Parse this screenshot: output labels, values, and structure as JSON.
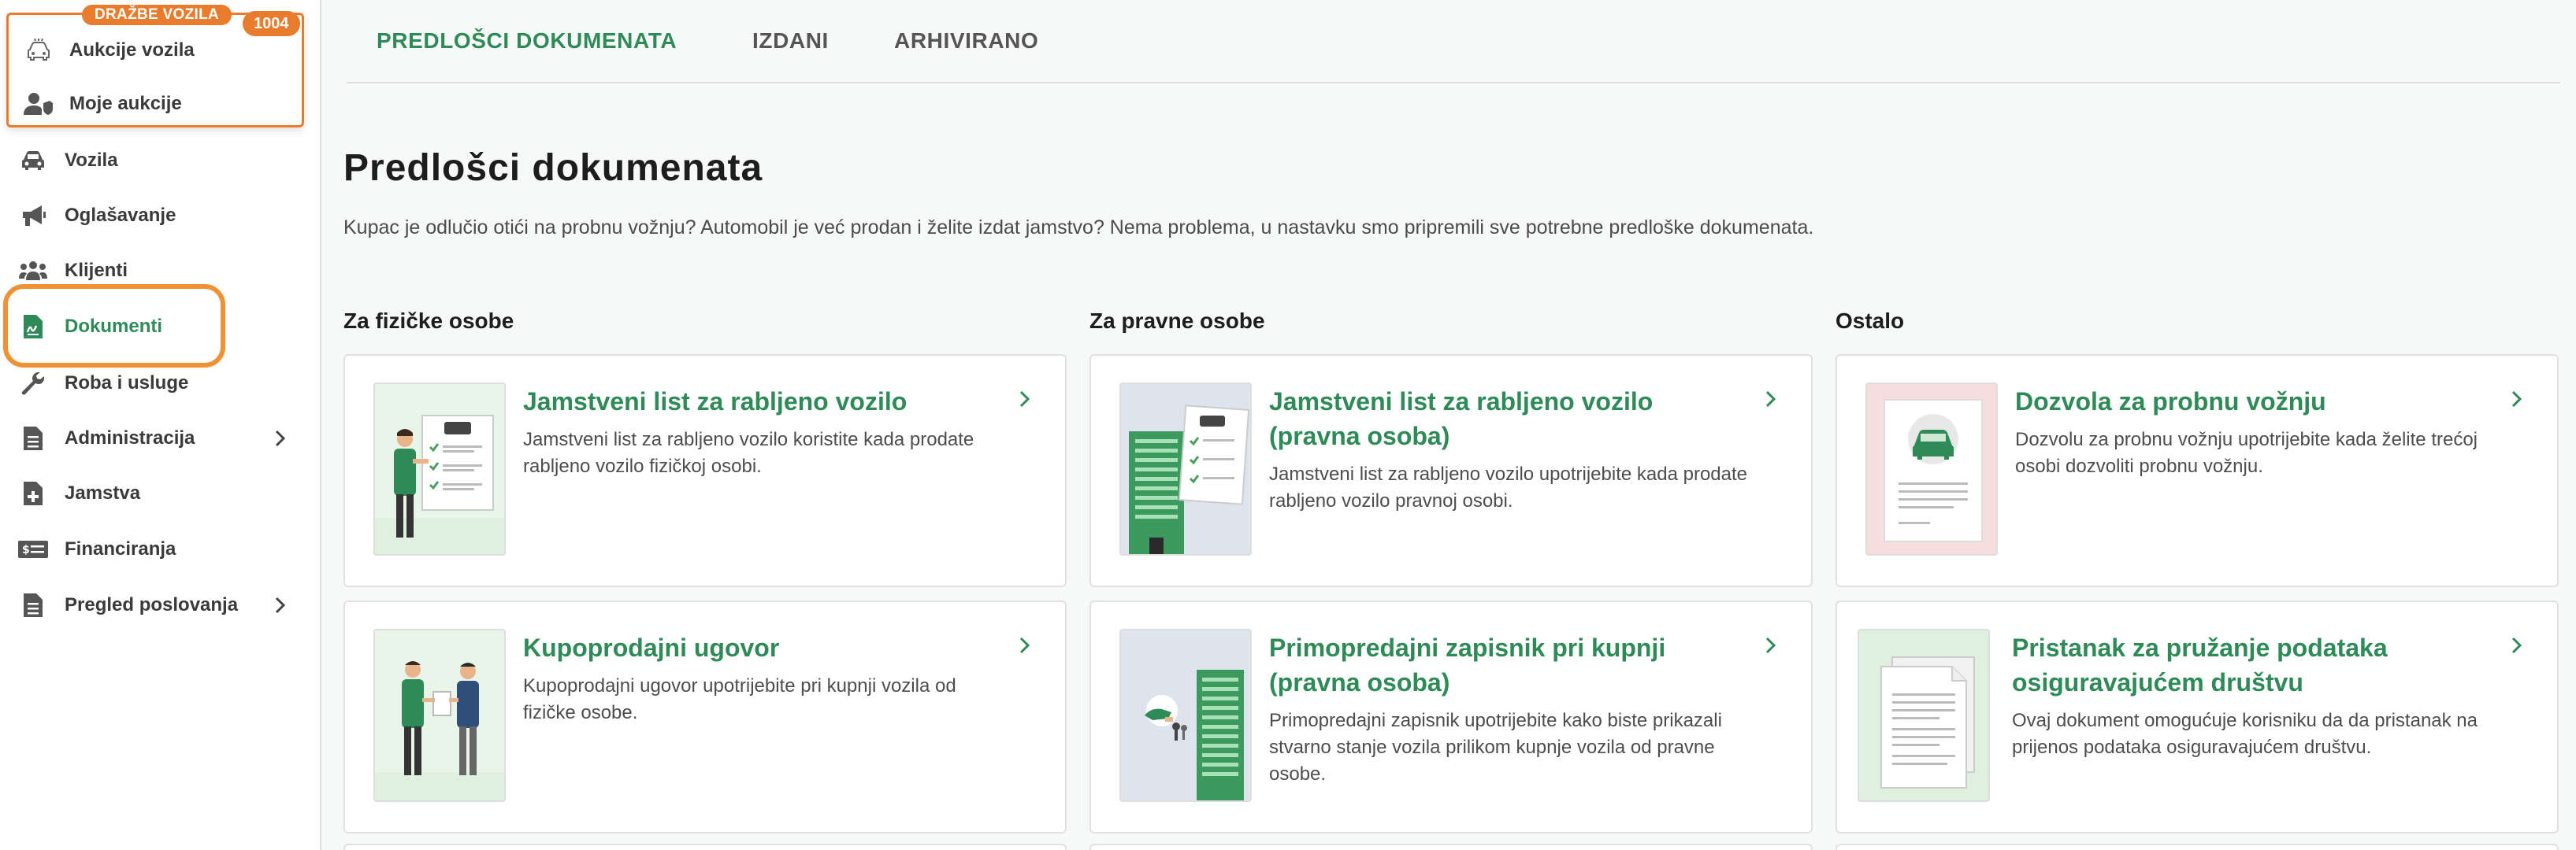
{
  "colors": {
    "accent": "#2e8b57",
    "auction_orange": "#e87b2c",
    "highlight": "#f09233"
  },
  "auction": {
    "tag": "DRAŽBE VOZILA",
    "count": "1004",
    "items": [
      {
        "label": "Aukcije vozila",
        "icon": "car-auction-icon"
      },
      {
        "label": "Moje aukcije",
        "icon": "user-shield-icon"
      }
    ]
  },
  "sidebar": {
    "items": [
      {
        "label": "Vozila",
        "icon": "car-icon"
      },
      {
        "label": "Oglašavanje",
        "icon": "megaphone-icon"
      },
      {
        "label": "Klijenti",
        "icon": "users-icon"
      },
      {
        "label": "Dokumenti",
        "icon": "document-icon",
        "active": true
      },
      {
        "label": "Roba i usluge",
        "icon": "wrench-icon"
      },
      {
        "label": "Administracija",
        "icon": "file-list-icon",
        "has_submenu": true
      },
      {
        "label": "Jamstva",
        "icon": "file-plus-icon"
      },
      {
        "label": "Financiranja",
        "icon": "money-icon"
      },
      {
        "label": "Pregled poslovanja",
        "icon": "file-chart-icon",
        "has_submenu": true
      }
    ]
  },
  "tabs": [
    {
      "label": "PREDLOŠCI DOKUMENATA",
      "active": true
    },
    {
      "label": "IZDANI"
    },
    {
      "label": "ARHIVIRANO"
    }
  ],
  "page": {
    "title": "Predlošci dokumenata",
    "description": "Kupac je odlučio otići na probnu vožnju? Automobil je već prodan i želite izdat jamstvo? Nema problema, u nastavku smo pripremili sve potrebne predloške dokumenata."
  },
  "columns": [
    {
      "title": "Za fizičke osobe"
    },
    {
      "title": "Za pravne osobe"
    },
    {
      "title": "Ostalo"
    }
  ],
  "cards": [
    {
      "title": "Jamstveni list za rabljeno vozilo",
      "description": "Jamstveni list za rabljeno vozilo koristite kada prodate rabljeno vozilo fizičkoj osobi.",
      "thumb": "person-warranty-illustration"
    },
    {
      "title": "Jamstveni list za rabljeno vozilo (pravna osoba)",
      "description": "Jamstveni list za rabljeno vozilo upotrijebite kada prodate rabljeno vozilo pravnoj osobi.",
      "thumb": "building-warranty-illustration"
    },
    {
      "title": "Dozvola za probnu vožnju",
      "description": "Dozvolu za probnu vožnju upotrijebite kada želite trećoj osobi dozvoliti probnu vožnju.",
      "thumb": "test-drive-document-illustration"
    },
    {
      "title": "Kupoprodajni ugovor",
      "description": "Kupoprodajni ugovor upotrijebite pri kupnji vozila od fizičke osobe.",
      "thumb": "two-people-contract-illustration"
    },
    {
      "title": "Primopredajni zapisnik pri kupnji (pravna osoba)",
      "description": "Primopredajni zapisnik upotrijebite kako biste prikazali stvarno stanje vozila prilikom kupnje vozila od pravne osobe.",
      "thumb": "keys-building-illustration"
    },
    {
      "title": "Pristanak za pružanje podataka osiguravajućem društvu",
      "description": "Ovaj dokument omogućuje korisniku da da pristanak na prijenos podataka osiguravajućem društvu.",
      "thumb": "document-pages-illustration"
    }
  ]
}
